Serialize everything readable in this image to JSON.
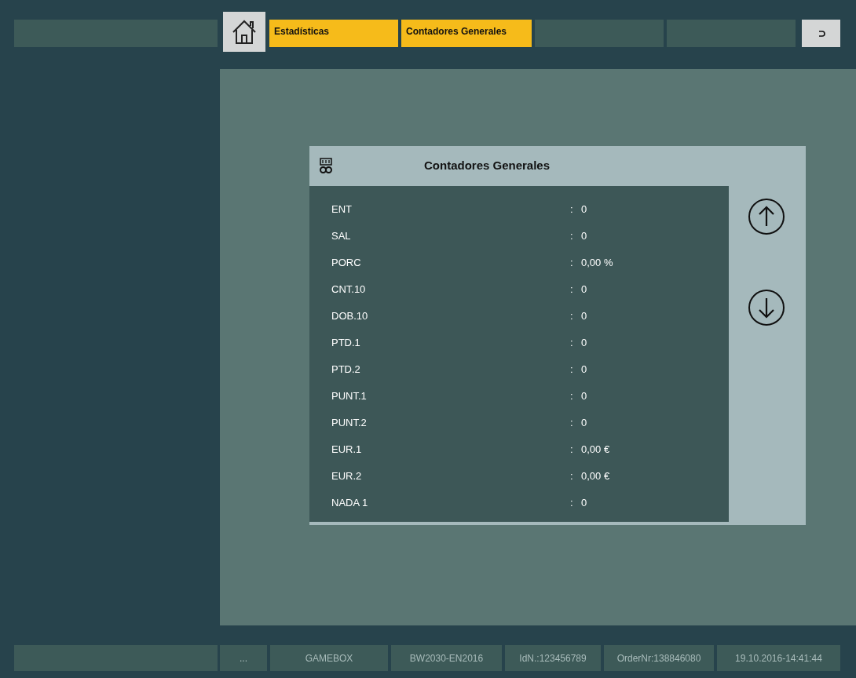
{
  "breadcrumbs": [
    {
      "label": "Estadísticas"
    },
    {
      "label": "Contadores Generales"
    }
  ],
  "dialog": {
    "title": "Contadores Generales",
    "rows": [
      {
        "name": "ENT",
        "separator": ":",
        "value": "0"
      },
      {
        "name": "SAL",
        "separator": ":",
        "value": "0"
      },
      {
        "name": "PORC",
        "separator": ":",
        "value": "0,00 %"
      },
      {
        "name": "CNT.10",
        "separator": ":",
        "value": "0"
      },
      {
        "name": "DOB.10",
        "separator": ":",
        "value": "0"
      },
      {
        "name": "PTD.1",
        "separator": ":",
        "value": "0"
      },
      {
        "name": "PTD.2",
        "separator": ":",
        "value": "0"
      },
      {
        "name": "PUNT.1",
        "separator": ":",
        "value": "0"
      },
      {
        "name": "PUNT.2",
        "separator": ":",
        "value": "0"
      },
      {
        "name": "EUR.1",
        "separator": ":",
        "value": "0,00 €"
      },
      {
        "name": "EUR.2",
        "separator": ":",
        "value": "0,00 €"
      },
      {
        "name": "NADA 1",
        "separator": ":",
        "value": "0"
      }
    ]
  },
  "status_bar": [
    "...",
    "GAMEBOX",
    "BW2030-EN2016",
    "IdN.:123456789",
    "OrderNr:138846080",
    "19.10.2016-14:41:44"
  ]
}
